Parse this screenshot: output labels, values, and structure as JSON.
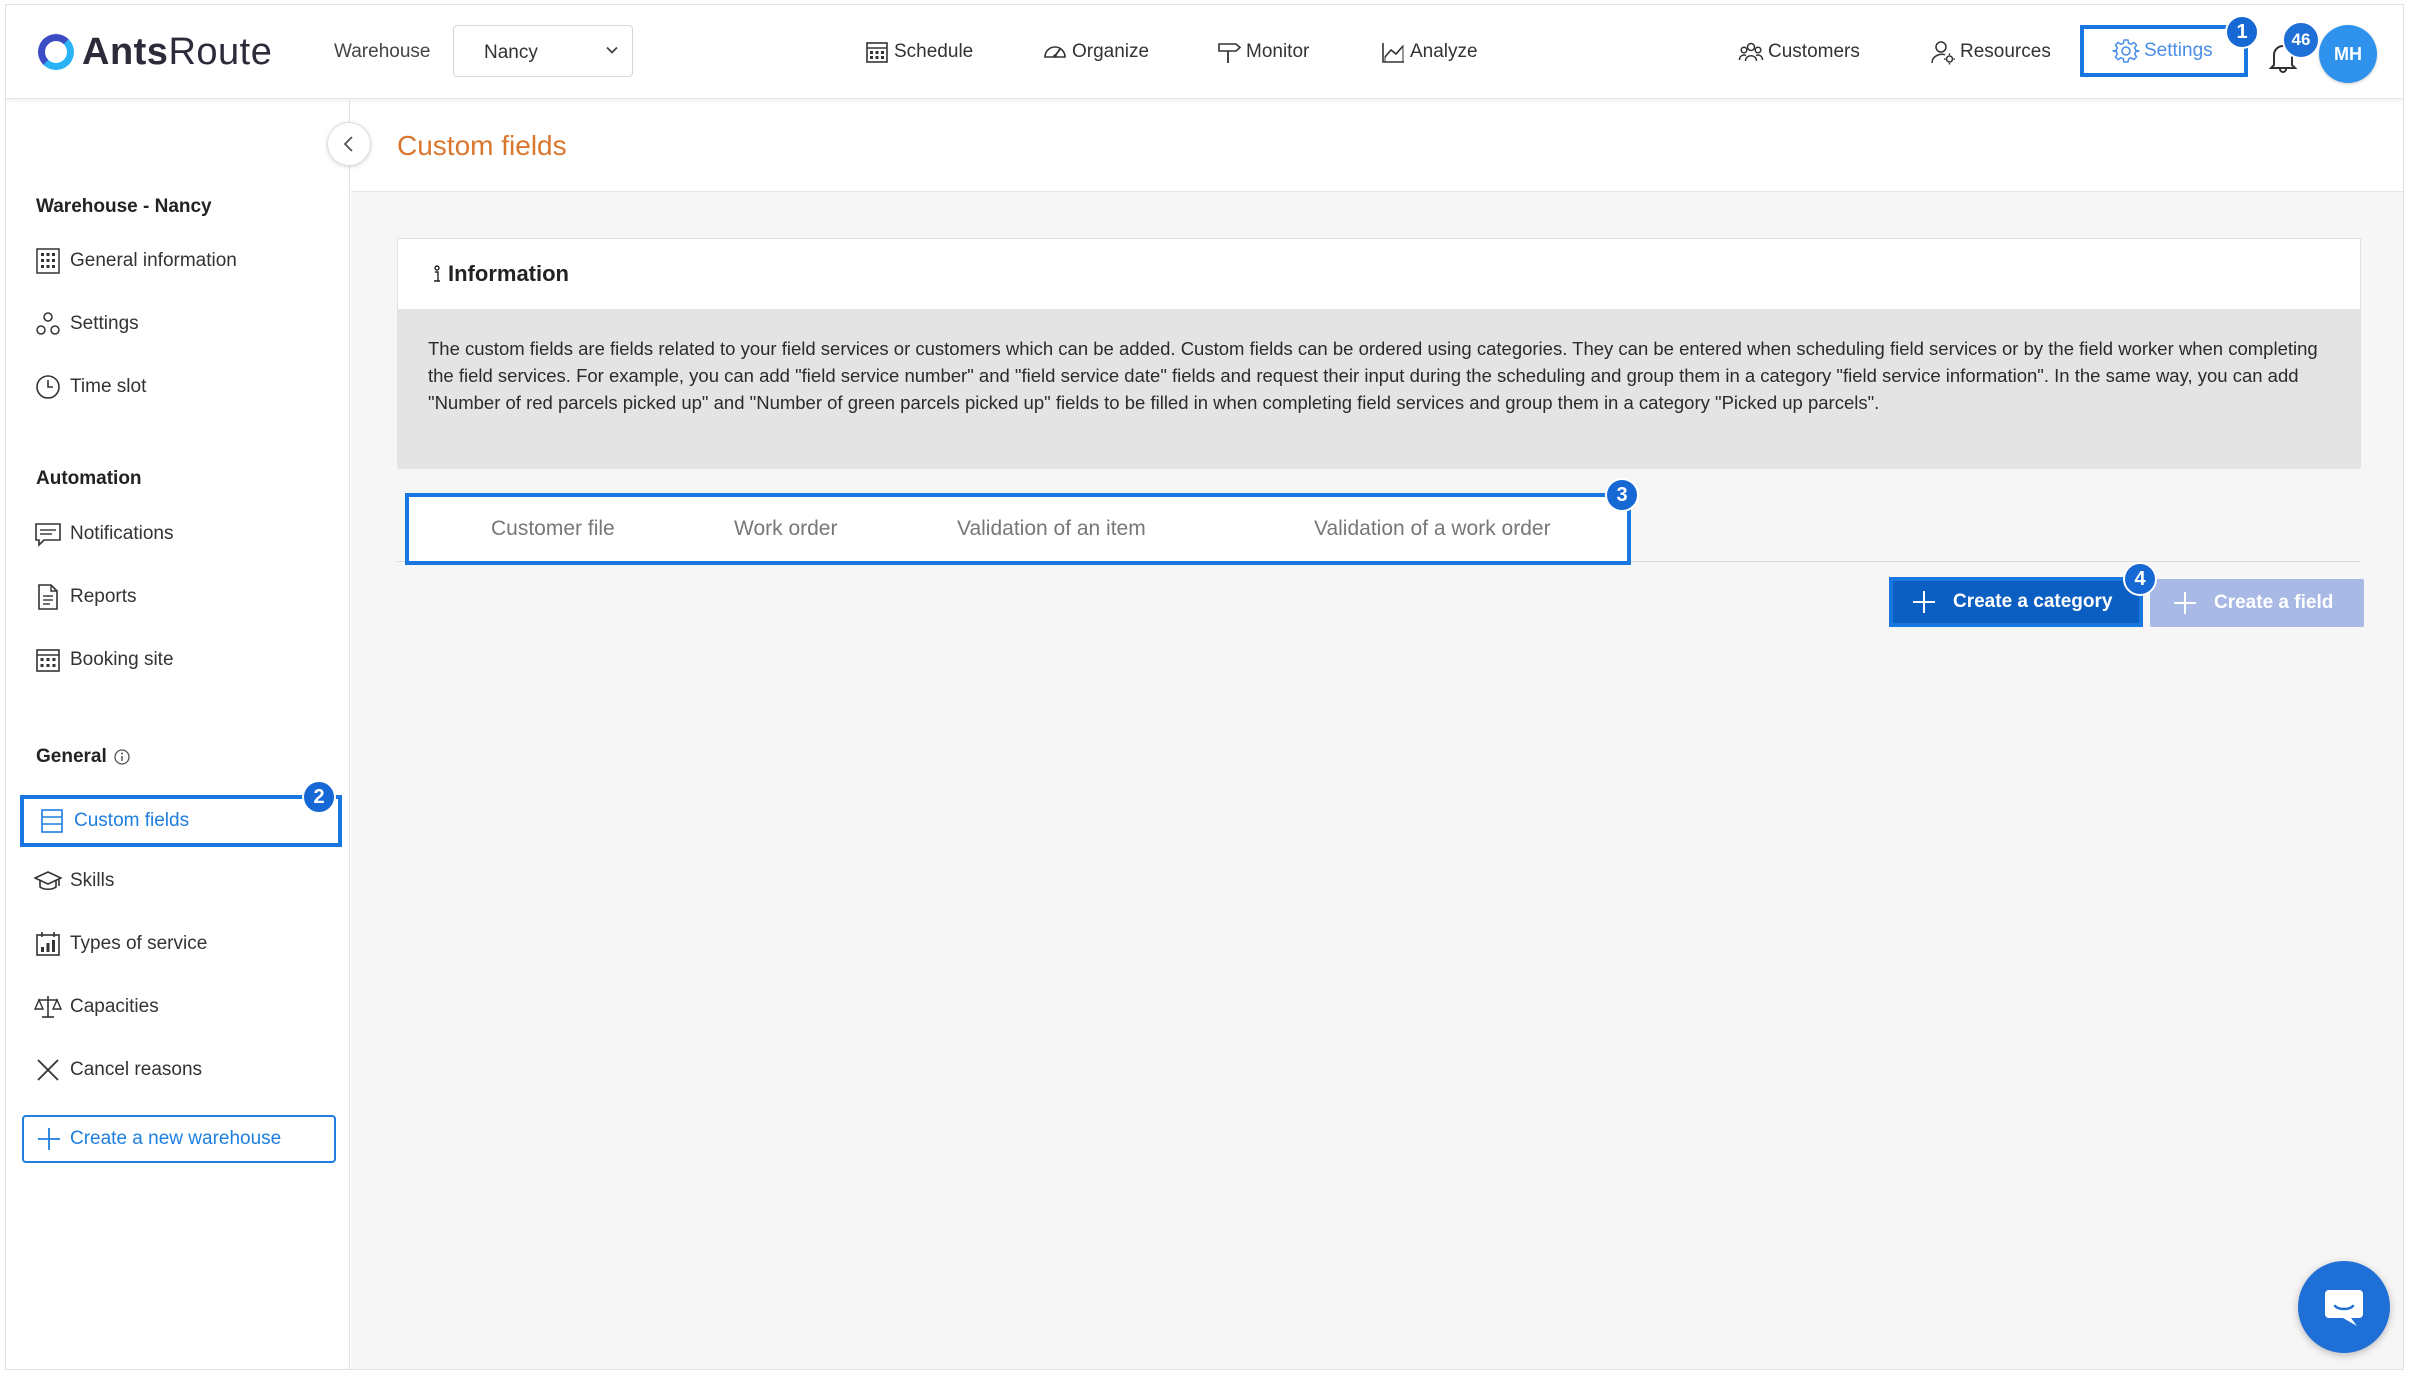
{
  "brand": {
    "name_bold": "Ants",
    "name_rest": "Route"
  },
  "warehouse": {
    "label": "Warehouse",
    "selected": "Nancy"
  },
  "nav": {
    "schedule": "Schedule",
    "organize": "Organize",
    "monitor": "Monitor",
    "analyze": "Analyze",
    "customers": "Customers",
    "resources": "Resources",
    "settings": "Settings"
  },
  "notifications": {
    "count": "46"
  },
  "user": {
    "initials": "MH"
  },
  "steps": {
    "one": "1",
    "two": "2",
    "three": "3",
    "four": "4"
  },
  "sidebar": {
    "warehouse_heading": "Warehouse - Nancy",
    "warehouse_items": [
      {
        "label": "General information",
        "icon": "building-grid-icon"
      },
      {
        "label": "Settings",
        "icon": "settings-shapes-icon"
      },
      {
        "label": "Time slot",
        "icon": "clock-icon"
      }
    ],
    "automation_heading": "Automation",
    "automation_items": [
      {
        "label": "Notifications",
        "icon": "message-icon"
      },
      {
        "label": "Reports",
        "icon": "document-icon"
      },
      {
        "label": "Booking site",
        "icon": "calendar-icon"
      }
    ],
    "general_heading": "General",
    "general_items": [
      {
        "label": "Custom fields",
        "icon": "table-rows-icon"
      },
      {
        "label": "Skills",
        "icon": "graduation-cap-icon"
      },
      {
        "label": "Types of service",
        "icon": "calendar-chart-icon"
      },
      {
        "label": "Capacities",
        "icon": "scale-icon"
      },
      {
        "label": "Cancel reasons",
        "icon": "close-icon"
      }
    ],
    "new_warehouse": "Create a new warehouse"
  },
  "page": {
    "title": "Custom fields",
    "info_title": "Information",
    "info_text": "The custom fields are fields related to your field services or customers which can be added. Custom fields can be ordered using categories. They can be entered when scheduling field services or by the field worker when completing the field services. For example, you can add \"field service number\" and \"field service date\" fields and request their input during the scheduling and group them in a category \"field service information\". In the same way, you can add \"Number of red parcels picked up\" and \"Number of green parcels picked up\" fields to be filled in when completing field services and group them in a category \"Picked up parcels\".",
    "tabs": [
      "Customer file",
      "Work order",
      "Validation of an item",
      "Validation of a work order"
    ],
    "create_category": "Create a category",
    "create_field": "Create a field"
  },
  "colors": {
    "accent": "#1877e0",
    "title_orange": "#d9772f",
    "primary_button": "#0b5fc2",
    "disabled_button": "#a9b9e6"
  }
}
